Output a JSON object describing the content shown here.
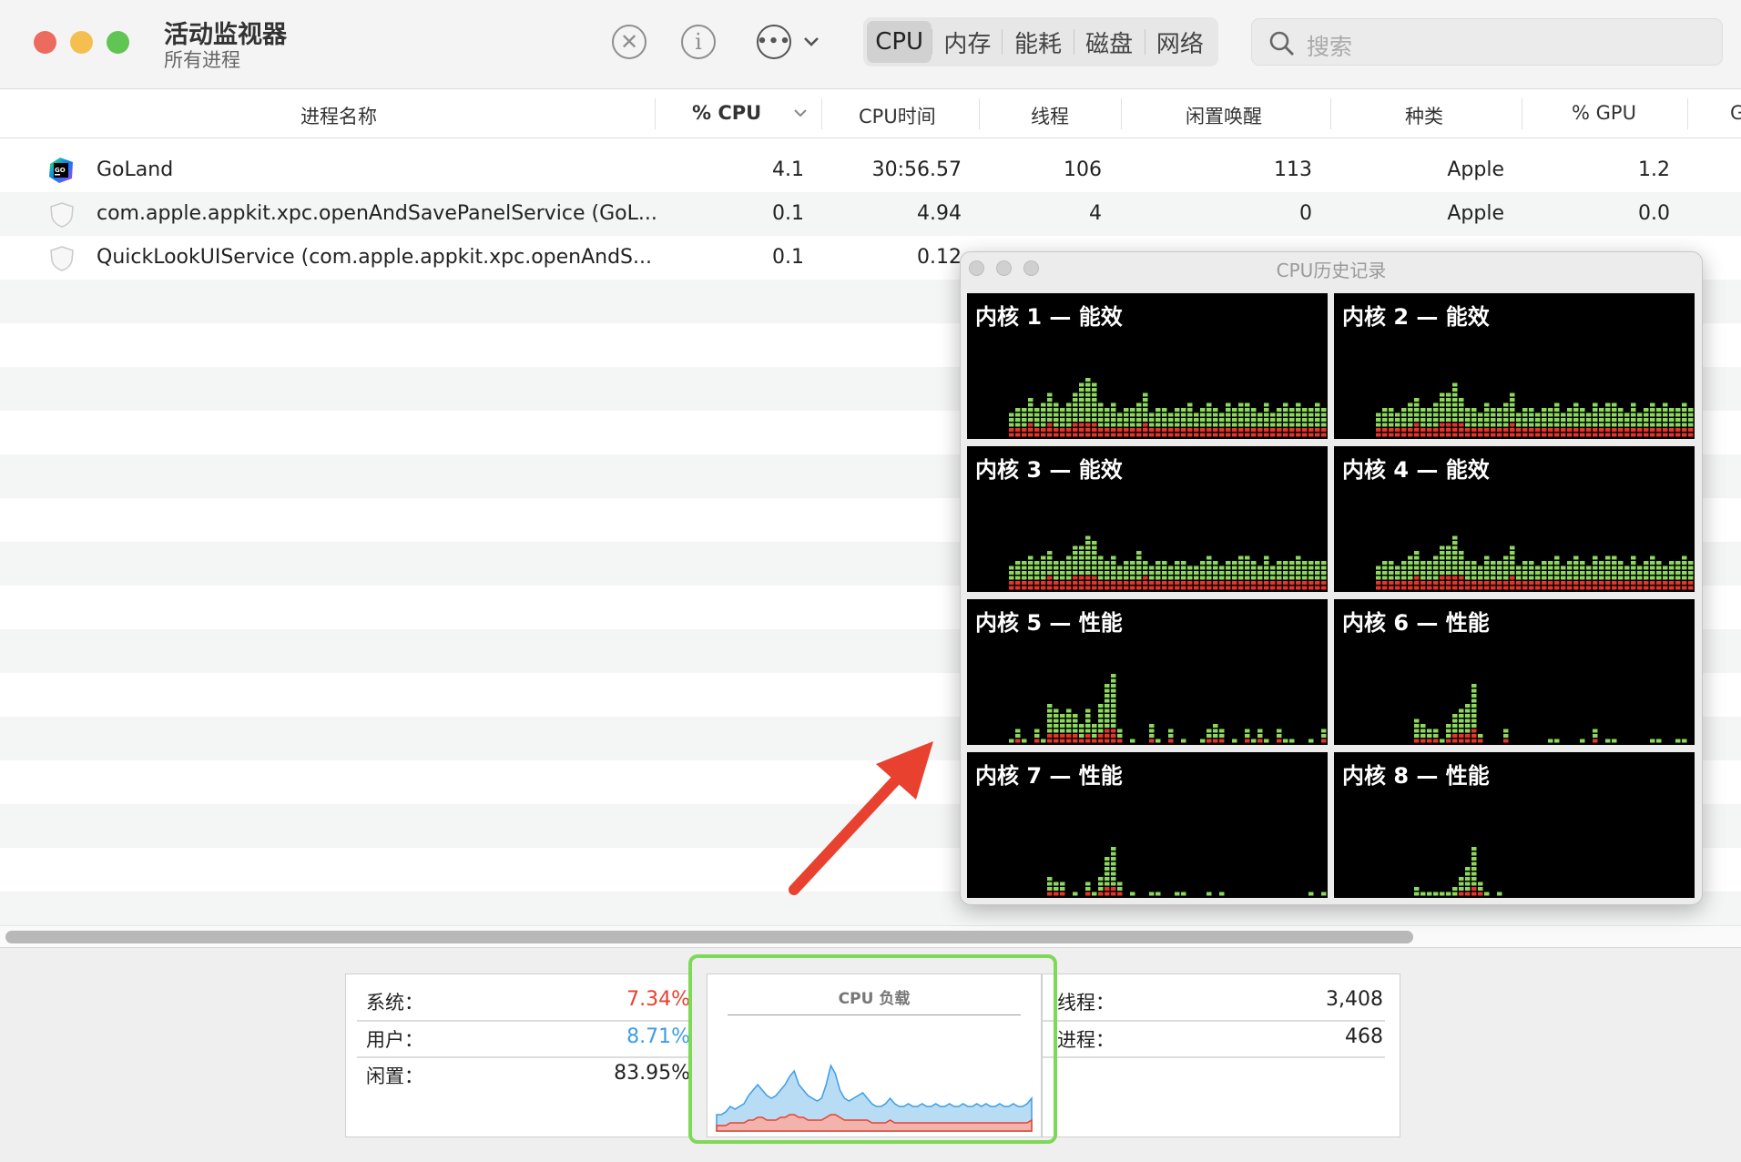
{
  "app": {
    "title": "活动监视器",
    "subtitle": "所有进程"
  },
  "window_controls": [
    {
      "name": "close",
      "color": "#ed6a5e"
    },
    {
      "name": "minimize",
      "color": "#f5bf4f"
    },
    {
      "name": "zoom",
      "color": "#61c554"
    }
  ],
  "toolbar": {
    "stop_icon": "x-circle-icon",
    "info_icon": "info-icon",
    "more_icon": "ellipsis-circle-icon",
    "tabs": [
      "CPU",
      "内存",
      "能耗",
      "磁盘",
      "网络"
    ],
    "active_tab": "CPU",
    "search_placeholder": "搜索"
  },
  "table": {
    "columns": [
      "进程名称",
      "% CPU",
      "CPU时间",
      "线程",
      "闲置唤醒",
      "种类",
      "% GPU",
      "G"
    ],
    "sort_column": "% CPU",
    "rows": [
      {
        "name": "GoLand",
        "cpu": "4.1",
        "cpu_time": "30:56.57",
        "threads": "106",
        "idle_wakeups": "113",
        "kind": "Apple",
        "gpu": "1.2",
        "icon": "goland-app-icon"
      },
      {
        "name": "com.apple.appkit.xpc.openAndSavePanelService (GoL...",
        "cpu": "0.1",
        "cpu_time": "4.94",
        "threads": "4",
        "idle_wakeups": "0",
        "kind": "Apple",
        "gpu": "0.0",
        "icon": "shield-icon"
      },
      {
        "name": "QuickLookUIService (com.apple.appkit.xpc.openAndS...",
        "cpu": "0.1",
        "cpu_time": "0.12",
        "threads": "",
        "idle_wakeups": "",
        "kind": "",
        "gpu": "",
        "icon": "shield-icon"
      }
    ]
  },
  "cpu_history": {
    "title": "CPU历史记录",
    "cores": [
      {
        "label": "内核 1 — 能效",
        "user_hist": [
          0,
          0,
          0,
          0,
          0,
          0,
          3,
          4,
          4,
          5,
          4,
          5,
          6,
          5,
          4,
          5,
          6,
          8,
          9,
          8,
          5,
          4,
          5,
          3,
          4,
          4,
          5,
          6,
          3,
          4,
          4,
          3,
          4,
          4,
          5,
          3,
          4,
          5,
          4,
          3,
          5,
          4,
          5,
          5,
          4,
          3,
          5,
          3,
          4,
          5,
          4,
          5,
          4,
          4,
          5,
          4
        ],
        "sys_hist": [
          0,
          0,
          0,
          0,
          0,
          0,
          2,
          2,
          2,
          3,
          2,
          2,
          3,
          2,
          2,
          2,
          3,
          3,
          3,
          3,
          2,
          2,
          2,
          2,
          2,
          2,
          2,
          3,
          2,
          2,
          2,
          2,
          2,
          2,
          2,
          2,
          2,
          2,
          2,
          2,
          2,
          2,
          2,
          2,
          2,
          2,
          2,
          2,
          2,
          2,
          2,
          2,
          2,
          2,
          2,
          2
        ]
      },
      {
        "label": "内核 2 — 能效",
        "user_hist": [
          0,
          0,
          0,
          0,
          0,
          0,
          3,
          4,
          4,
          3,
          4,
          5,
          5,
          4,
          4,
          5,
          6,
          6,
          8,
          5,
          4,
          4,
          3,
          5,
          4,
          4,
          5,
          6,
          3,
          4,
          4,
          3,
          4,
          4,
          5,
          3,
          4,
          5,
          4,
          3,
          5,
          4,
          5,
          5,
          4,
          3,
          5,
          3,
          4,
          5,
          4,
          5,
          4,
          4,
          5,
          4
        ],
        "sys_hist": [
          0,
          0,
          0,
          0,
          0,
          0,
          2,
          2,
          2,
          2,
          2,
          2,
          3,
          2,
          2,
          2,
          3,
          3,
          3,
          3,
          2,
          2,
          2,
          2,
          2,
          2,
          2,
          3,
          2,
          2,
          2,
          2,
          2,
          2,
          2,
          2,
          2,
          2,
          2,
          2,
          2,
          2,
          2,
          2,
          2,
          2,
          2,
          2,
          2,
          2,
          2,
          2,
          2,
          2,
          2,
          2
        ]
      },
      {
        "label": "内核 3 — 能效",
        "user_hist": [
          0,
          0,
          0,
          0,
          0,
          0,
          3,
          4,
          4,
          5,
          4,
          5,
          5,
          4,
          4,
          5,
          6,
          6,
          8,
          7,
          5,
          4,
          5,
          3,
          4,
          4,
          6,
          3,
          3,
          4,
          4,
          3,
          4,
          4,
          3,
          3,
          4,
          5,
          4,
          3,
          4,
          4,
          5,
          5,
          4,
          3,
          5,
          3,
          4,
          4,
          4,
          5,
          4,
          4,
          4,
          4
        ],
        "sys_hist": [
          0,
          0,
          0,
          0,
          0,
          0,
          2,
          2,
          2,
          2,
          2,
          2,
          3,
          2,
          2,
          2,
          3,
          3,
          3,
          3,
          2,
          2,
          2,
          2,
          2,
          2,
          2,
          3,
          2,
          2,
          2,
          2,
          2,
          2,
          2,
          2,
          2,
          2,
          2,
          2,
          2,
          2,
          2,
          2,
          2,
          2,
          2,
          2,
          2,
          2,
          2,
          2,
          2,
          2,
          2,
          2
        ]
      },
      {
        "label": "内核 4 — 能效",
        "user_hist": [
          0,
          0,
          0,
          0,
          0,
          0,
          3,
          4,
          4,
          3,
          4,
          5,
          5,
          4,
          4,
          5,
          6,
          6,
          8,
          5,
          4,
          4,
          3,
          5,
          4,
          4,
          5,
          6,
          3,
          4,
          4,
          3,
          4,
          4,
          5,
          3,
          4,
          5,
          4,
          3,
          5,
          4,
          5,
          5,
          4,
          3,
          5,
          3,
          4,
          5,
          4,
          3,
          4,
          4,
          5,
          4
        ],
        "sys_hist": [
          0,
          0,
          0,
          0,
          0,
          0,
          2,
          2,
          2,
          2,
          2,
          2,
          3,
          2,
          2,
          2,
          3,
          3,
          3,
          3,
          2,
          2,
          2,
          2,
          2,
          2,
          2,
          3,
          2,
          2,
          2,
          2,
          2,
          2,
          2,
          2,
          2,
          2,
          2,
          2,
          2,
          2,
          2,
          2,
          2,
          2,
          2,
          2,
          2,
          2,
          2,
          2,
          2,
          2,
          2,
          2
        ]
      },
      {
        "label": "内核 5 — 性能",
        "user_hist": [
          0,
          0,
          0,
          0,
          0,
          0,
          1,
          2,
          1,
          0,
          2,
          1,
          6,
          5,
          4,
          5,
          4,
          3,
          5,
          3,
          6,
          9,
          11,
          2,
          0,
          1,
          0,
          0,
          3,
          1,
          0,
          2,
          0,
          1,
          0,
          0,
          1,
          2,
          3,
          2,
          0,
          1,
          0,
          2,
          1,
          2,
          1,
          0,
          2,
          1,
          1,
          0,
          0,
          1,
          0,
          2
        ],
        "sys_hist": [
          0,
          0,
          0,
          0,
          0,
          0,
          0,
          1,
          0,
          0,
          1,
          0,
          2,
          2,
          2,
          2,
          2,
          1,
          2,
          1,
          2,
          3,
          3,
          1,
          0,
          0,
          0,
          0,
          1,
          0,
          0,
          1,
          0,
          0,
          0,
          0,
          0,
          1,
          1,
          1,
          0,
          0,
          0,
          1,
          0,
          1,
          0,
          0,
          1,
          0,
          0,
          0,
          0,
          0,
          0,
          1
        ]
      },
      {
        "label": "内核 6 — 性能",
        "user_hist": [
          0,
          0,
          0,
          0,
          0,
          0,
          0,
          0,
          0,
          0,
          0,
          0,
          4,
          3,
          2,
          2,
          1,
          3,
          4,
          5,
          6,
          9,
          1,
          0,
          0,
          0,
          2,
          0,
          0,
          0,
          0,
          0,
          0,
          1,
          1,
          0,
          0,
          0,
          1,
          0,
          2,
          0,
          1,
          1,
          0,
          0,
          0,
          0,
          0,
          1,
          1,
          0,
          0,
          1,
          1,
          0
        ],
        "sys_hist": [
          0,
          0,
          0,
          0,
          0,
          0,
          0,
          0,
          0,
          0,
          0,
          0,
          1,
          1,
          1,
          1,
          0,
          1,
          2,
          2,
          2,
          3,
          1,
          0,
          0,
          0,
          1,
          0,
          0,
          0,
          0,
          0,
          0,
          0,
          0,
          0,
          0,
          0,
          0,
          0,
          1,
          0,
          0,
          0,
          0,
          0,
          0,
          0,
          0,
          0,
          0,
          0,
          0,
          0,
          0,
          0
        ]
      },
      {
        "label": "内核 7 — 性能",
        "user_hist": [
          0,
          0,
          0,
          0,
          0,
          0,
          0,
          0,
          0,
          0,
          0,
          0,
          3,
          2,
          2,
          0,
          1,
          0,
          2,
          1,
          3,
          6,
          8,
          2,
          0,
          1,
          0,
          0,
          1,
          1,
          0,
          0,
          1,
          1,
          0,
          0,
          0,
          1,
          0,
          1,
          0,
          0,
          0,
          0,
          0,
          0,
          0,
          0,
          0,
          0,
          0,
          0,
          0,
          1,
          0,
          1
        ],
        "sys_hist": [
          0,
          0,
          0,
          0,
          0,
          0,
          0,
          0,
          0,
          0,
          0,
          0,
          1,
          1,
          1,
          0,
          0,
          0,
          1,
          0,
          1,
          2,
          2,
          1,
          0,
          0,
          0,
          0,
          0,
          0,
          0,
          0,
          0,
          0,
          0,
          0,
          0,
          0,
          0,
          0,
          0,
          0,
          0,
          0,
          0,
          0,
          0,
          0,
          0,
          0,
          0,
          0,
          0,
          0,
          0,
          0
        ]
      },
      {
        "label": "内核 8 — 性能",
        "user_hist": [
          0,
          0,
          0,
          0,
          0,
          0,
          0,
          0,
          0,
          0,
          0,
          0,
          2,
          1,
          1,
          1,
          1,
          1,
          2,
          3,
          5,
          8,
          2,
          1,
          0,
          1,
          0,
          0,
          0,
          0,
          0,
          0,
          0,
          0,
          0,
          0,
          0,
          0,
          0,
          0,
          0,
          0,
          0,
          0,
          0,
          0,
          0,
          0,
          0,
          0,
          0,
          0,
          0,
          0,
          0,
          0
        ],
        "sys_hist": [
          0,
          0,
          0,
          0,
          0,
          0,
          0,
          0,
          0,
          0,
          0,
          0,
          0,
          0,
          0,
          0,
          0,
          0,
          0,
          1,
          1,
          2,
          1,
          0,
          0,
          0,
          0,
          0,
          0,
          0,
          0,
          0,
          0,
          0,
          0,
          0,
          0,
          0,
          0,
          0,
          0,
          0,
          0,
          0,
          0,
          0,
          0,
          0,
          0,
          0,
          0,
          0,
          0,
          0,
          0,
          0
        ]
      }
    ]
  },
  "stats": {
    "system_label": "系统：",
    "system_value": "7.34%",
    "user_label": "用户：",
    "user_value": "8.71%",
    "idle_label": "闲置：",
    "idle_value": "83.95%",
    "threads_label": "线程：",
    "threads_value": "3,408",
    "processes_label": "进程：",
    "processes_value": "468",
    "load_title": "CPU 负载"
  },
  "colors": {
    "system_red": "#e8412f",
    "user_blue": "#3b9de8",
    "bar_green": "#8bd85b",
    "bar_red": "#e5342a",
    "arrow": "#e8412f",
    "highlight_box": "#7ed957"
  },
  "cpu_load_data": {
    "user_pct": [
      4,
      4,
      5,
      6,
      5,
      6,
      7,
      9,
      11,
      12,
      10,
      9,
      8,
      9,
      10,
      12,
      14,
      16,
      12,
      10,
      9,
      8,
      7,
      8,
      12,
      18,
      15,
      10,
      8,
      7,
      8,
      9,
      10,
      8,
      7,
      6,
      6,
      7,
      8,
      7,
      6,
      6,
      7,
      6,
      6,
      7,
      6,
      6,
      7,
      6,
      6,
      7,
      6,
      6,
      7,
      6,
      6,
      7,
      6,
      7,
      6,
      6,
      7,
      6,
      6,
      7,
      6,
      6,
      7,
      8
    ],
    "system_pct": [
      2,
      2,
      2,
      3,
      3,
      3,
      3,
      4,
      4,
      5,
      5,
      4,
      4,
      4,
      5,
      5,
      6,
      6,
      5,
      5,
      4,
      4,
      4,
      4,
      5,
      6,
      6,
      5,
      4,
      4,
      4,
      4,
      4,
      4,
      3,
      3,
      3,
      3,
      4,
      3,
      3,
      3,
      3,
      3,
      3,
      3,
      3,
      3,
      3,
      3,
      3,
      3,
      3,
      3,
      3,
      3,
      3,
      3,
      3,
      3,
      3,
      3,
      3,
      3,
      3,
      3,
      3,
      3,
      3,
      4
    ]
  }
}
